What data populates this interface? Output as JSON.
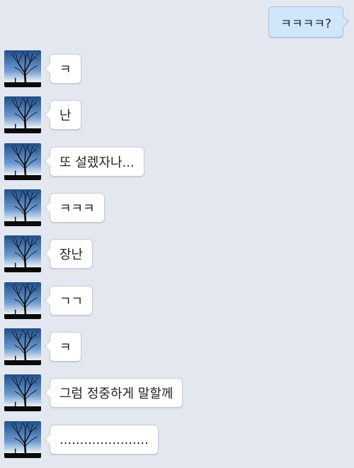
{
  "sent_messages": [
    {
      "text": "ㅋㅋㅋㅋ?"
    }
  ],
  "received_messages": [
    {
      "text": "ㅋ",
      "avatar_icon": "tree-silhouette-avatar-icon"
    },
    {
      "text": "난",
      "avatar_icon": "tree-silhouette-avatar-icon"
    },
    {
      "text": "또 설렜자나...",
      "avatar_icon": "tree-silhouette-avatar-icon"
    },
    {
      "text": "ㅋㅋㅋ",
      "avatar_icon": "tree-silhouette-avatar-icon"
    },
    {
      "text": "장난",
      "avatar_icon": "tree-silhouette-avatar-icon"
    },
    {
      "text": "ㄱㄱ",
      "avatar_icon": "tree-silhouette-avatar-icon"
    },
    {
      "text": "ㅋ",
      "avatar_icon": "tree-silhouette-avatar-icon"
    },
    {
      "text": "그럼 정중하게 말할께",
      "avatar_icon": "tree-silhouette-avatar-icon"
    },
    {
      "text": "......................",
      "avatar_icon": "tree-silhouette-avatar-icon"
    }
  ],
  "colors": {
    "background": "#e3e8f0",
    "sent_bubble": "#cfe6fb",
    "received_bubble": "#ffffff"
  }
}
